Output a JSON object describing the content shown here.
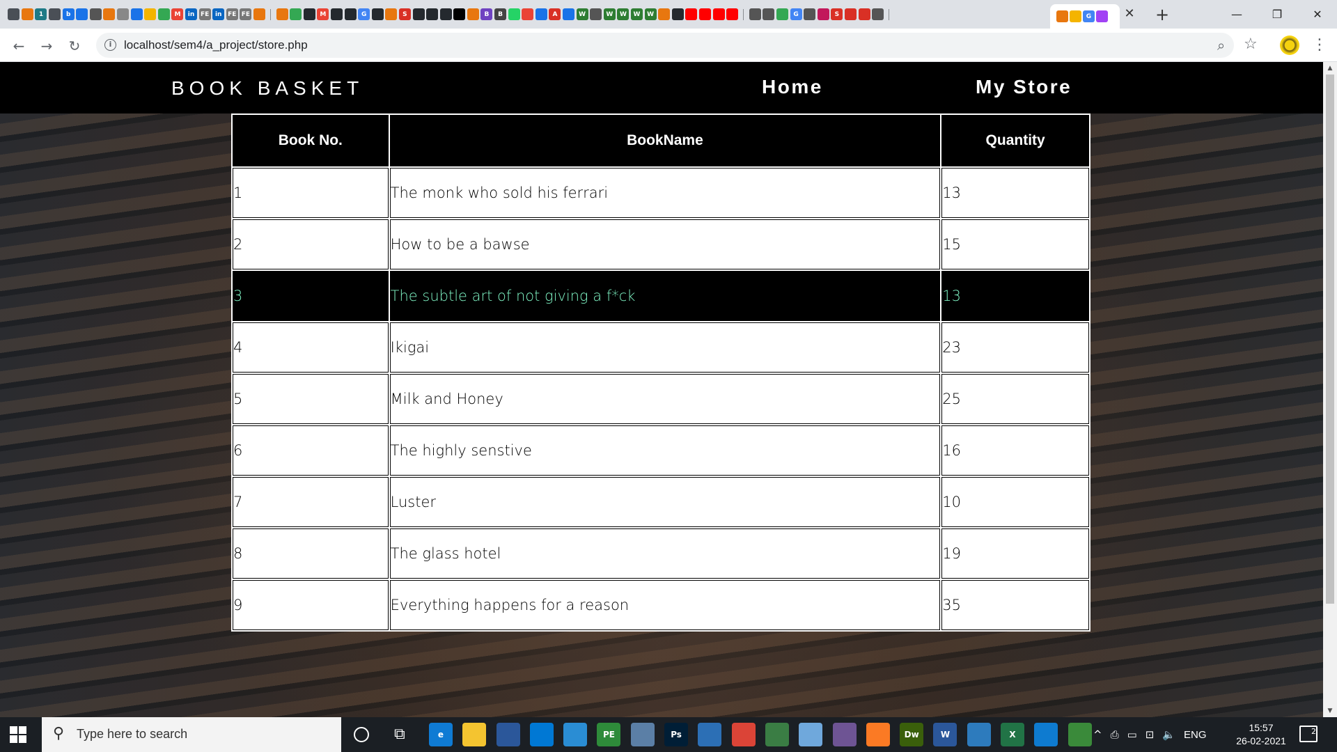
{
  "browser": {
    "url": "localhost/sem4/a_project/store.php",
    "tab_close": "✕",
    "new_tab": "+",
    "minimize": "—",
    "restore": "❐",
    "close": "✕",
    "back": "←",
    "forward": "→",
    "reload": "↻",
    "menu": "⋮",
    "tab_favicons": [
      {
        "label": "",
        "color": "#4a4f56"
      },
      {
        "label": "",
        "color": "#e8770f"
      },
      {
        "label": "1",
        "color": "#1d7a86"
      },
      {
        "label": "",
        "color": "#4a4f56"
      },
      {
        "label": "b",
        "color": "#1a73e8"
      },
      {
        "label": "",
        "color": "#1a73e8"
      },
      {
        "label": "",
        "color": "#555"
      },
      {
        "label": "",
        "color": "#e8770f"
      },
      {
        "label": "",
        "color": "#888"
      },
      {
        "label": "",
        "color": "#1a73e8"
      },
      {
        "label": "",
        "color": "#f4b400"
      },
      {
        "label": "",
        "color": "#34a853"
      },
      {
        "label": "M",
        "color": "#ea4335"
      },
      {
        "label": "in",
        "color": "#0a66c2"
      },
      {
        "label": "FE",
        "color": "#777"
      },
      {
        "label": "in",
        "color": "#0a66c2"
      },
      {
        "label": "FE",
        "color": "#777"
      },
      {
        "label": "FE",
        "color": "#777"
      },
      {
        "label": "",
        "color": "#e8770f"
      }
    ],
    "tab_favicons_2": [
      {
        "label": "",
        "color": "#e8770f"
      },
      {
        "label": "",
        "color": "#34a853"
      },
      {
        "label": "",
        "color": "#24292e"
      },
      {
        "label": "M",
        "color": "#ea4335"
      },
      {
        "label": "",
        "color": "#24292e"
      },
      {
        "label": "",
        "color": "#24292e"
      },
      {
        "label": "G",
        "color": "#4285f4"
      },
      {
        "label": "",
        "color": "#24292e"
      },
      {
        "label": "",
        "color": "#e8770f"
      },
      {
        "label": "S",
        "color": "#d93025"
      },
      {
        "label": "",
        "color": "#24292e"
      },
      {
        "label": "",
        "color": "#24292e"
      },
      {
        "label": "",
        "color": "#24292e"
      },
      {
        "label": "",
        "color": "#000"
      },
      {
        "label": "",
        "color": "#e8770f"
      },
      {
        "label": "B",
        "color": "#6f42c1"
      },
      {
        "label": "B",
        "color": "#444"
      },
      {
        "label": "",
        "color": "#25d366"
      },
      {
        "label": "",
        "color": "#ea4335"
      },
      {
        "label": "",
        "color": "#1a73e8"
      },
      {
        "label": "A",
        "color": "#d93025"
      },
      {
        "label": "",
        "color": "#1a73e8"
      },
      {
        "label": "W",
        "color": "#2e7d32"
      },
      {
        "label": "",
        "color": "#555"
      },
      {
        "label": "W",
        "color": "#2e7d32"
      },
      {
        "label": "W",
        "color": "#2e7d32"
      },
      {
        "label": "W",
        "color": "#2e7d32"
      },
      {
        "label": "W",
        "color": "#2e7d32"
      },
      {
        "label": "",
        "color": "#e8770f"
      },
      {
        "label": "",
        "color": "#24292e"
      },
      {
        "label": "",
        "color": "#ff0000"
      },
      {
        "label": "",
        "color": "#ff0000"
      },
      {
        "label": "",
        "color": "#ff0000"
      },
      {
        "label": "",
        "color": "#ff0000"
      }
    ],
    "tab_favicons_3": [
      {
        "label": "",
        "color": "#555"
      },
      {
        "label": "",
        "color": "#555"
      },
      {
        "label": "",
        "color": "#34a853"
      },
      {
        "label": "G",
        "color": "#4285f4"
      },
      {
        "label": "",
        "color": "#555"
      },
      {
        "label": "",
        "color": "#c2185b"
      },
      {
        "label": "S",
        "color": "#d93025"
      },
      {
        "label": "",
        "color": "#d93025"
      },
      {
        "label": "",
        "color": "#d93025"
      },
      {
        "label": "",
        "color": "#555"
      }
    ],
    "active_tab_favicons": [
      {
        "label": "",
        "color": "#e8770f"
      },
      {
        "label": "",
        "color": "#f4b400"
      },
      {
        "label": "G",
        "color": "#4285f4"
      },
      {
        "label": "",
        "color": "#a142f4"
      }
    ]
  },
  "site": {
    "brand": "BOOK BASKET",
    "nav": {
      "home": "Home",
      "my_store": "My Store"
    }
  },
  "table": {
    "headers": [
      "Book No.",
      "BookName",
      "Quantity"
    ],
    "highlighted_row": 3,
    "rows": [
      {
        "no": "1",
        "name": "The monk who sold his ferrari",
        "qty": "13"
      },
      {
        "no": "2",
        "name": "How to be a bawse",
        "qty": "15"
      },
      {
        "no": "3",
        "name": "The subtle art of not giving a f*ck",
        "qty": "13"
      },
      {
        "no": "4",
        "name": "Ikigai",
        "qty": "23"
      },
      {
        "no": "5",
        "name": "Milk and Honey",
        "qty": "25"
      },
      {
        "no": "6",
        "name": "The highly senstive",
        "qty": "16"
      },
      {
        "no": "7",
        "name": "Luster",
        "qty": "10"
      },
      {
        "no": "8",
        "name": "The glass hotel",
        "qty": "19"
      },
      {
        "no": "9",
        "name": "Everything happens for a reason",
        "qty": "35"
      }
    ],
    "highlight_text_color": "#7ff4c4"
  },
  "taskbar": {
    "search_placeholder": "Type here to search",
    "apps": [
      {
        "name": "edge",
        "label": "e",
        "color": "#0f7bd4"
      },
      {
        "name": "file-explorer",
        "label": "",
        "color": "#f4c430"
      },
      {
        "name": "store",
        "label": "",
        "color": "#2b579a"
      },
      {
        "name": "mail",
        "label": "",
        "color": "#0078d4"
      },
      {
        "name": "outlook",
        "label": "",
        "color": "#2a8dd4"
      },
      {
        "name": "pe",
        "label": "PE",
        "color": "#2e8b3a"
      },
      {
        "name": "paint",
        "label": "",
        "color": "#5b7fa6"
      },
      {
        "name": "photoshop",
        "label": "Ps",
        "color": "#001e36"
      },
      {
        "name": "app-square",
        "label": "",
        "color": "#2c6fb5"
      },
      {
        "name": "chrome",
        "label": "",
        "color": "#db4437"
      },
      {
        "name": "image-viewer",
        "label": "",
        "color": "#3a7d44"
      },
      {
        "name": "notes",
        "label": "",
        "color": "#6fa8dc"
      },
      {
        "name": "github",
        "label": "",
        "color": "#6e5494"
      },
      {
        "name": "xampp",
        "label": "",
        "color": "#fb7a24"
      },
      {
        "name": "dreamweaver",
        "label": "Dw",
        "color": "#3a5f0b"
      },
      {
        "name": "word",
        "label": "W",
        "color": "#2b579a"
      },
      {
        "name": "photos",
        "label": "",
        "color": "#2d7bbd"
      },
      {
        "name": "excel",
        "label": "X",
        "color": "#217346"
      },
      {
        "name": "vscode",
        "label": "",
        "color": "#0e7bd0"
      },
      {
        "name": "git",
        "label": "",
        "color": "#3a8a3a"
      }
    ],
    "tray": [
      "^",
      "⎙",
      "▭",
      "⊡",
      "🔈"
    ],
    "language": "ENG",
    "time": "15:57",
    "date": "26-02-2021",
    "notifications": "2"
  }
}
